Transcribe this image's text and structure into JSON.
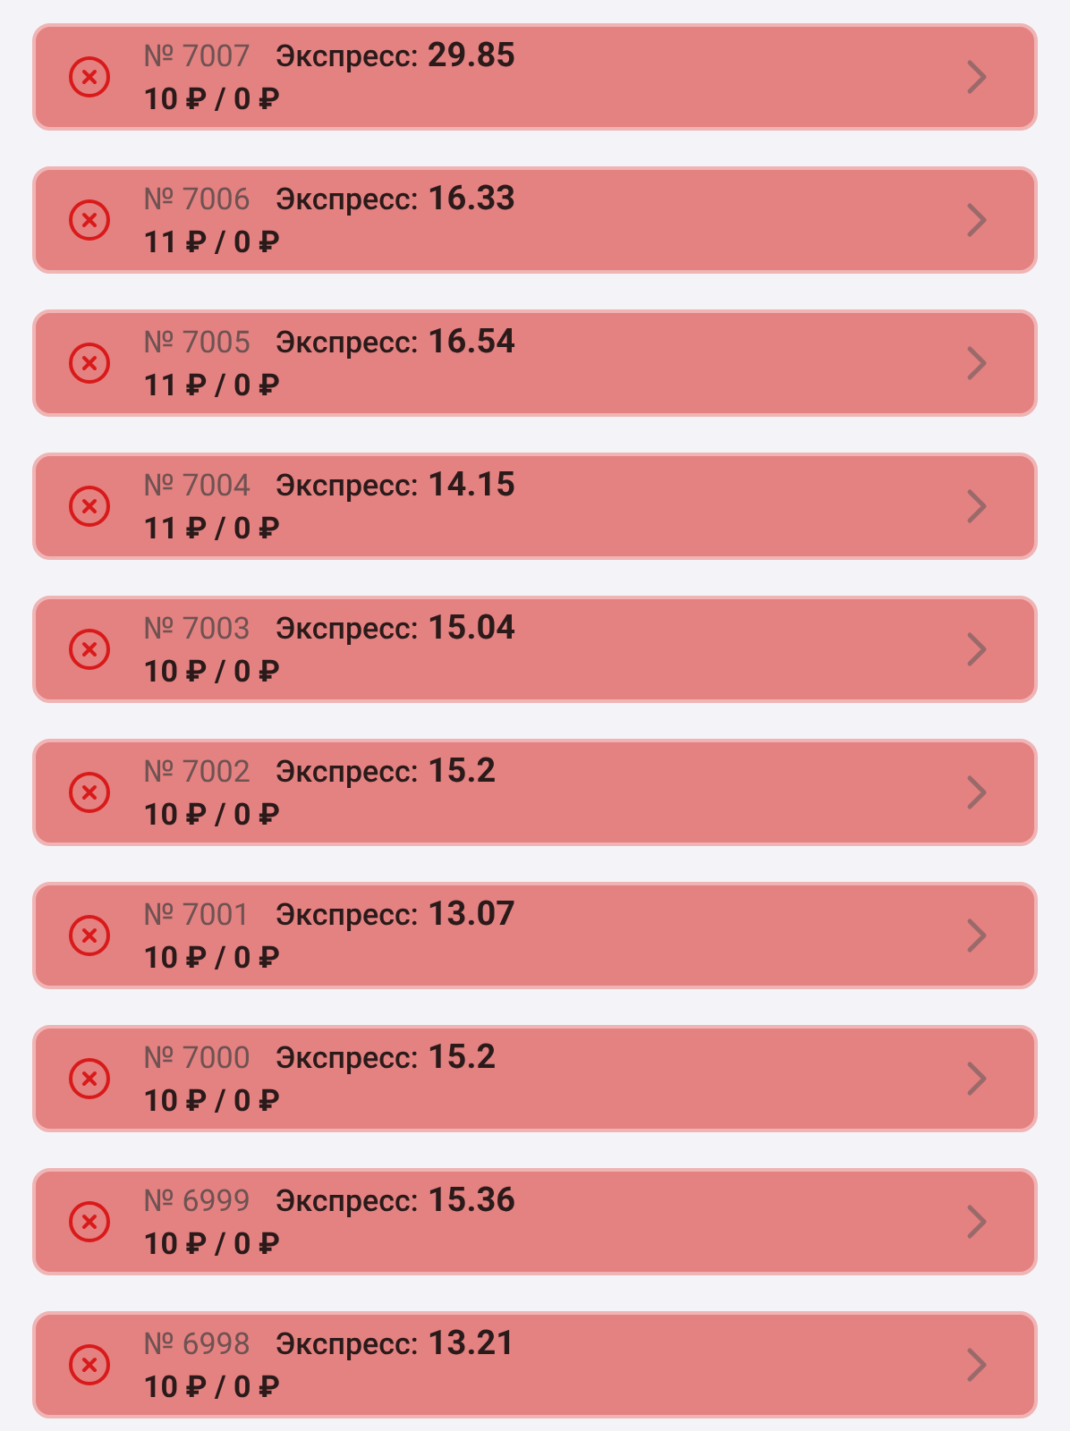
{
  "bets": [
    {
      "kind": "lost",
      "number": "№ 7007",
      "type": "Экспресс:",
      "coefficient": "29.85",
      "amounts": "10 ₽ / 0 ₽"
    },
    {
      "kind": "lost",
      "number": "№ 7006",
      "type": "Экспресс:",
      "coefficient": "16.33",
      "amounts": "11 ₽ / 0 ₽"
    },
    {
      "kind": "lost",
      "number": "№ 7005",
      "type": "Экспресс:",
      "coefficient": "16.54",
      "amounts": "11 ₽ / 0 ₽"
    },
    {
      "kind": "lost",
      "number": "№ 7004",
      "type": "Экспресс:",
      "coefficient": "14.15",
      "amounts": "11 ₽ / 0 ₽"
    },
    {
      "kind": "lost",
      "number": "№ 7003",
      "type": "Экспресс:",
      "coefficient": "15.04",
      "amounts": "10 ₽ / 0 ₽"
    },
    {
      "kind": "lost",
      "number": "№ 7002",
      "type": "Экспресс:",
      "coefficient": "15.2",
      "amounts": "10 ₽ / 0 ₽"
    },
    {
      "kind": "lost",
      "number": "№ 7001",
      "type": "Экспресс:",
      "coefficient": "13.07",
      "amounts": "10 ₽ / 0 ₽"
    },
    {
      "kind": "lost",
      "number": "№ 7000",
      "type": "Экспресс:",
      "coefficient": "15.2",
      "amounts": "10 ₽ / 0 ₽"
    },
    {
      "kind": "lost",
      "number": "№ 6999",
      "type": "Экспресс:",
      "coefficient": "15.36",
      "amounts": "10 ₽ / 0 ₽"
    },
    {
      "kind": "lost",
      "number": "№ 6998",
      "type": "Экспресс:",
      "coefficient": "13.21",
      "amounts": "10 ₽ / 0 ₽"
    }
  ]
}
